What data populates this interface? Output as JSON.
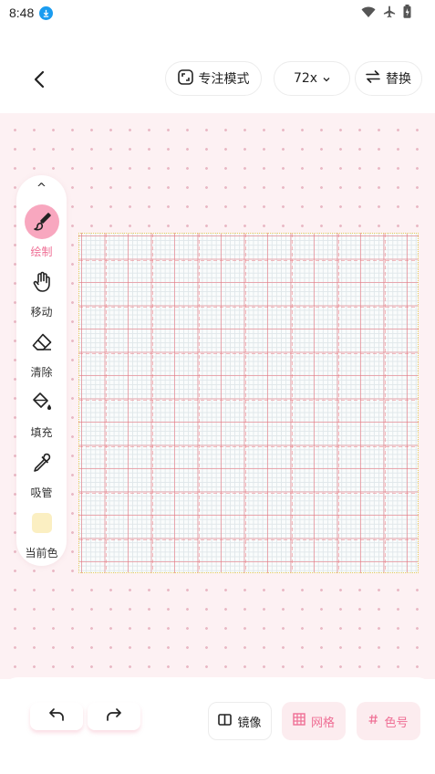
{
  "status_bar": {
    "time": "8:48"
  },
  "top_bar": {
    "focus_mode_label": "专注模式",
    "zoom_label": "72x",
    "replace_label": "替换"
  },
  "toolbar": {
    "collapse_glyph": "^",
    "tools": [
      {
        "label": "绘制",
        "icon": "brush-icon",
        "active": true
      },
      {
        "label": "移动",
        "icon": "hand-icon",
        "active": false
      },
      {
        "label": "清除",
        "icon": "eraser-icon",
        "active": false
      },
      {
        "label": "填充",
        "icon": "fill-bucket-icon",
        "active": false
      },
      {
        "label": "吸管",
        "icon": "eyedropper-icon",
        "active": false
      }
    ],
    "current_color_label": "当前色",
    "current_color": "#fbefc2"
  },
  "canvas": {
    "grid_size": 72,
    "accent": "#ef6f95"
  },
  "bottom_bar": {
    "mirror_label": "镜像",
    "grid_label": "网格",
    "color_number_label": "色号"
  }
}
